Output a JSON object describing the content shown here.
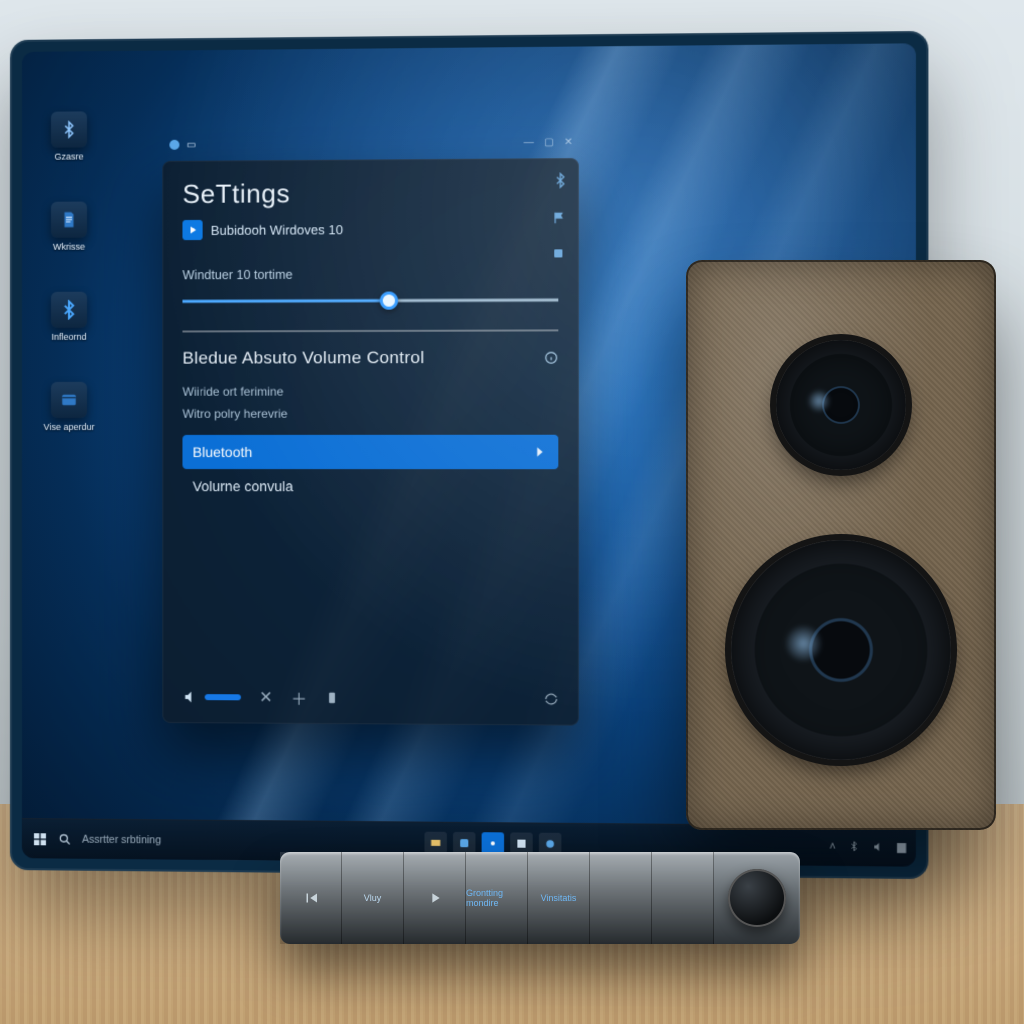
{
  "desktop_icons": [
    {
      "name": "bluetooth",
      "label": "Gzasre"
    },
    {
      "name": "document",
      "label": "Wkrisse"
    },
    {
      "name": "bluetooth-2",
      "label": "Infleornd"
    },
    {
      "name": "media",
      "label": "Vise aperdur"
    }
  ],
  "panel": {
    "titlebar_icons": [
      "-",
      "□",
      "✕"
    ],
    "title": "SeTtings",
    "breadcrumb": "Bubidooh Wirdoves 10",
    "setting_label": "Windtuer 10 tortime",
    "section_title": "Bledue Absuto Volume Control",
    "sub1": "Wiiride ort ferimine",
    "sub2": "Witro polry herevrie",
    "items": [
      {
        "label": "Bluetooth",
        "active": true
      },
      {
        "label": "Volurne convula",
        "active": false
      }
    ],
    "slider_percent": 55
  },
  "taskbar": {
    "search_hint": "Assrtter srbtining"
  },
  "dock": {
    "labels": [
      "Vluy",
      "Grontting mondire",
      "Vinsitatis",
      ""
    ]
  }
}
